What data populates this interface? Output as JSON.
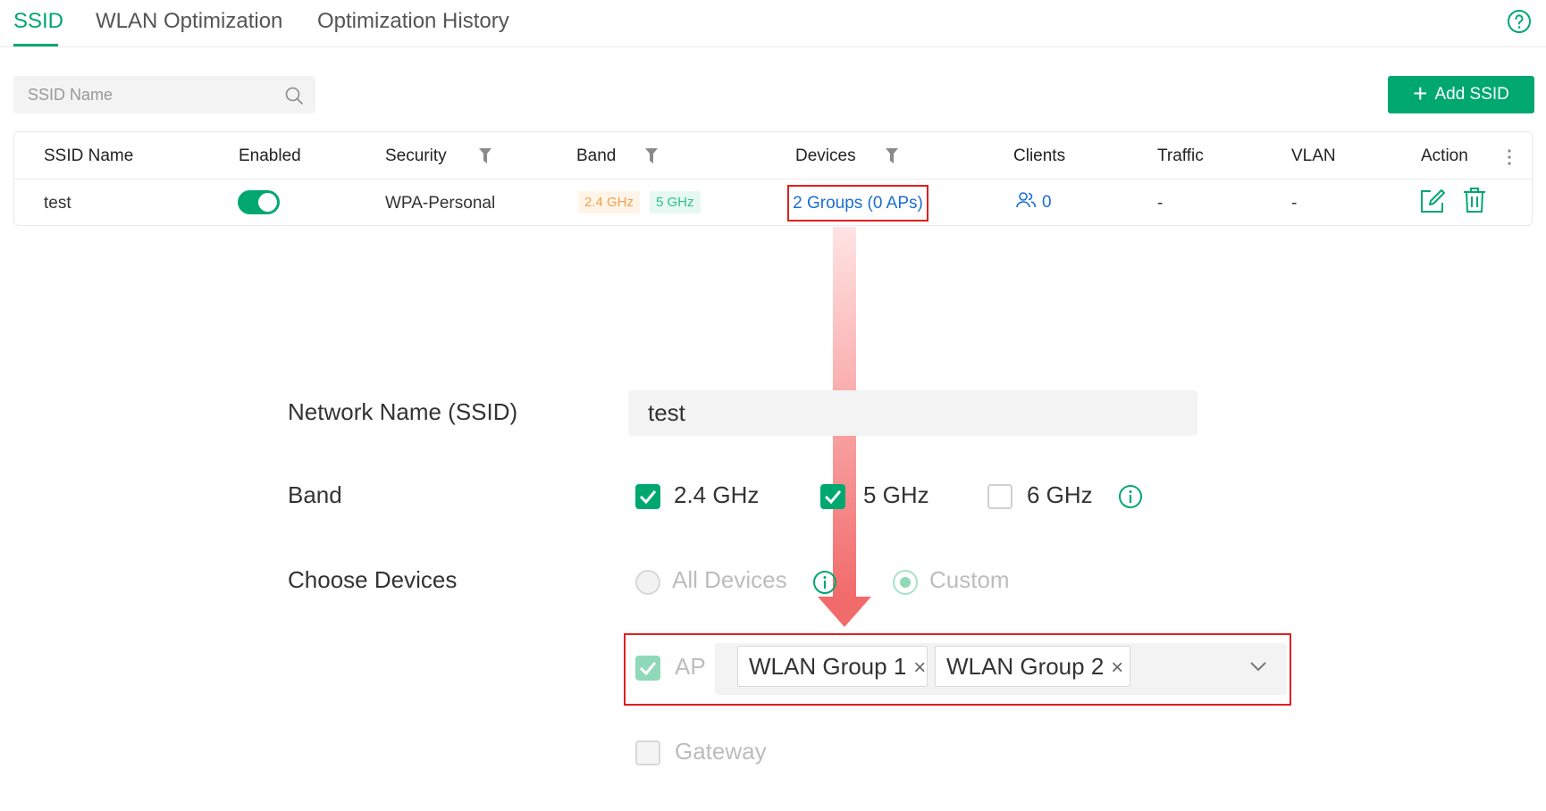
{
  "tabs": [
    {
      "label": "SSID",
      "active": true
    },
    {
      "label": "WLAN Optimization",
      "active": false
    },
    {
      "label": "Optimization History",
      "active": false
    }
  ],
  "search": {
    "placeholder": "SSID Name"
  },
  "add_button": {
    "label": "Add SSID"
  },
  "table": {
    "headers": [
      "SSID Name",
      "Enabled",
      "Security",
      "Band",
      "Devices",
      "Clients",
      "Traffic",
      "VLAN",
      "Action"
    ],
    "row": {
      "ssid_name": "test",
      "enabled": true,
      "security": "WPA-Personal",
      "band_tags": [
        "2.4 GHz",
        "5 GHz"
      ],
      "devices": "2 Groups (0 APs)",
      "clients": "0",
      "traffic": "-",
      "vlan": "-"
    }
  },
  "form": {
    "network_name_label": "Network Name (SSID)",
    "network_name_value": "test",
    "band_label": "Band",
    "band_options": [
      {
        "label": "2.4 GHz",
        "checked": true
      },
      {
        "label": "5 GHz",
        "checked": true
      },
      {
        "label": "6 GHz",
        "checked": false
      }
    ],
    "choose_devices_label": "Choose Devices",
    "device_scope": [
      {
        "label": "All Devices",
        "selected": false
      },
      {
        "label": "Custom",
        "selected": true
      }
    ],
    "ap_label": "AP",
    "ap_checked": true,
    "ap_groups": [
      "WLAN Group 1",
      "WLAN Group 2"
    ],
    "gateway_label": "Gateway",
    "gateway_checked": false
  },
  "colors": {
    "accent": "#00a870",
    "link": "#1a6fd0",
    "highlight": "#e02020"
  }
}
